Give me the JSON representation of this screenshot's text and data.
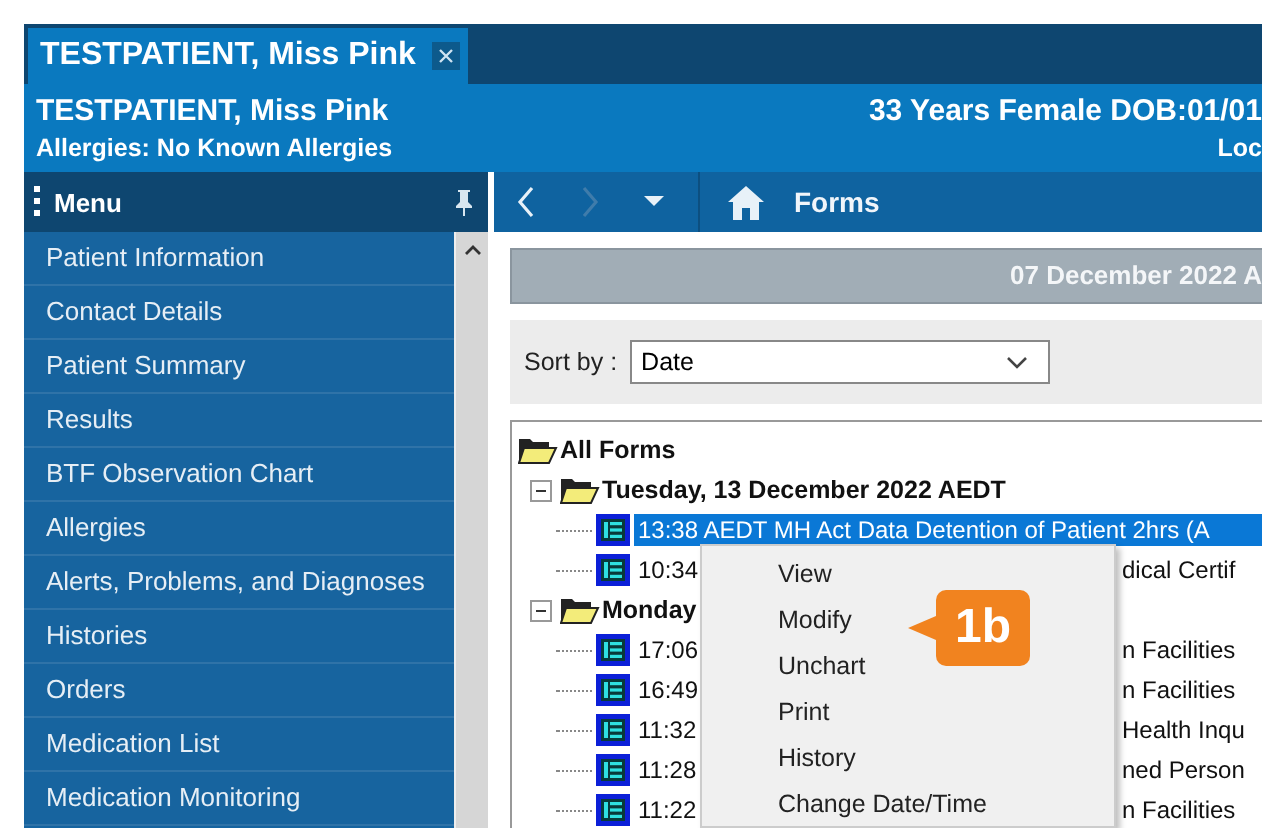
{
  "tab": {
    "label": "TESTPATIENT, Miss Pink",
    "selected": true
  },
  "banner": {
    "name": "TESTPATIENT, Miss Pink",
    "demographics": "33 Years Female DOB:01/01",
    "allergies": "Allergies: No Known Allergies",
    "location": "Loc"
  },
  "menu": {
    "title": "Menu",
    "items": [
      {
        "label": "Patient Information"
      },
      {
        "label": "Contact Details"
      },
      {
        "label": "Patient Summary"
      },
      {
        "label": "Results"
      },
      {
        "label": "BTF Observation Chart"
      },
      {
        "label": "Allergies"
      },
      {
        "label": "Alerts, Problems, and Diagnoses"
      },
      {
        "label": "Histories"
      },
      {
        "label": "Orders"
      },
      {
        "label": "Medication List"
      },
      {
        "label": "Medication Monitoring"
      }
    ]
  },
  "toolbar": {
    "back_disabled": false,
    "forward_disabled": true,
    "title": "Forms"
  },
  "forms": {
    "date_banner": "07 December 2022 A",
    "sort_label": "Sort by :",
    "sort_value": "Date",
    "tree": {
      "label": "All Forms",
      "children": [
        {
          "label": "Tuesday, 13 December 2022 AEDT",
          "expanded": true,
          "children": [
            {
              "text": "13:38 AEDT MH Act Data Detention of Patient 2hrs (A",
              "selected": true
            },
            {
              "text": "10:34",
              "tail": "dical Certif",
              "selected": false
            }
          ]
        },
        {
          "label": "Monday",
          "expanded": true,
          "children": [
            {
              "text": "17:06",
              "tail": "n Facilities",
              "selected": false
            },
            {
              "text": "16:49",
              "tail": "n Facilities",
              "selected": false
            },
            {
              "text": "11:32",
              "tail": "Health Inqu",
              "selected": false
            },
            {
              "text": "11:28",
              "tail": "ned Person",
              "selected": false
            },
            {
              "text": "11:22",
              "tail": "n Facilities",
              "selected": false
            }
          ]
        }
      ]
    }
  },
  "context_menu": {
    "items": [
      {
        "label": "View"
      },
      {
        "label": "Modify"
      },
      {
        "label": "Unchart"
      },
      {
        "label": "Print"
      },
      {
        "label": "History"
      },
      {
        "label": "Change Date/Time"
      }
    ]
  },
  "callout": {
    "text": "1b"
  }
}
